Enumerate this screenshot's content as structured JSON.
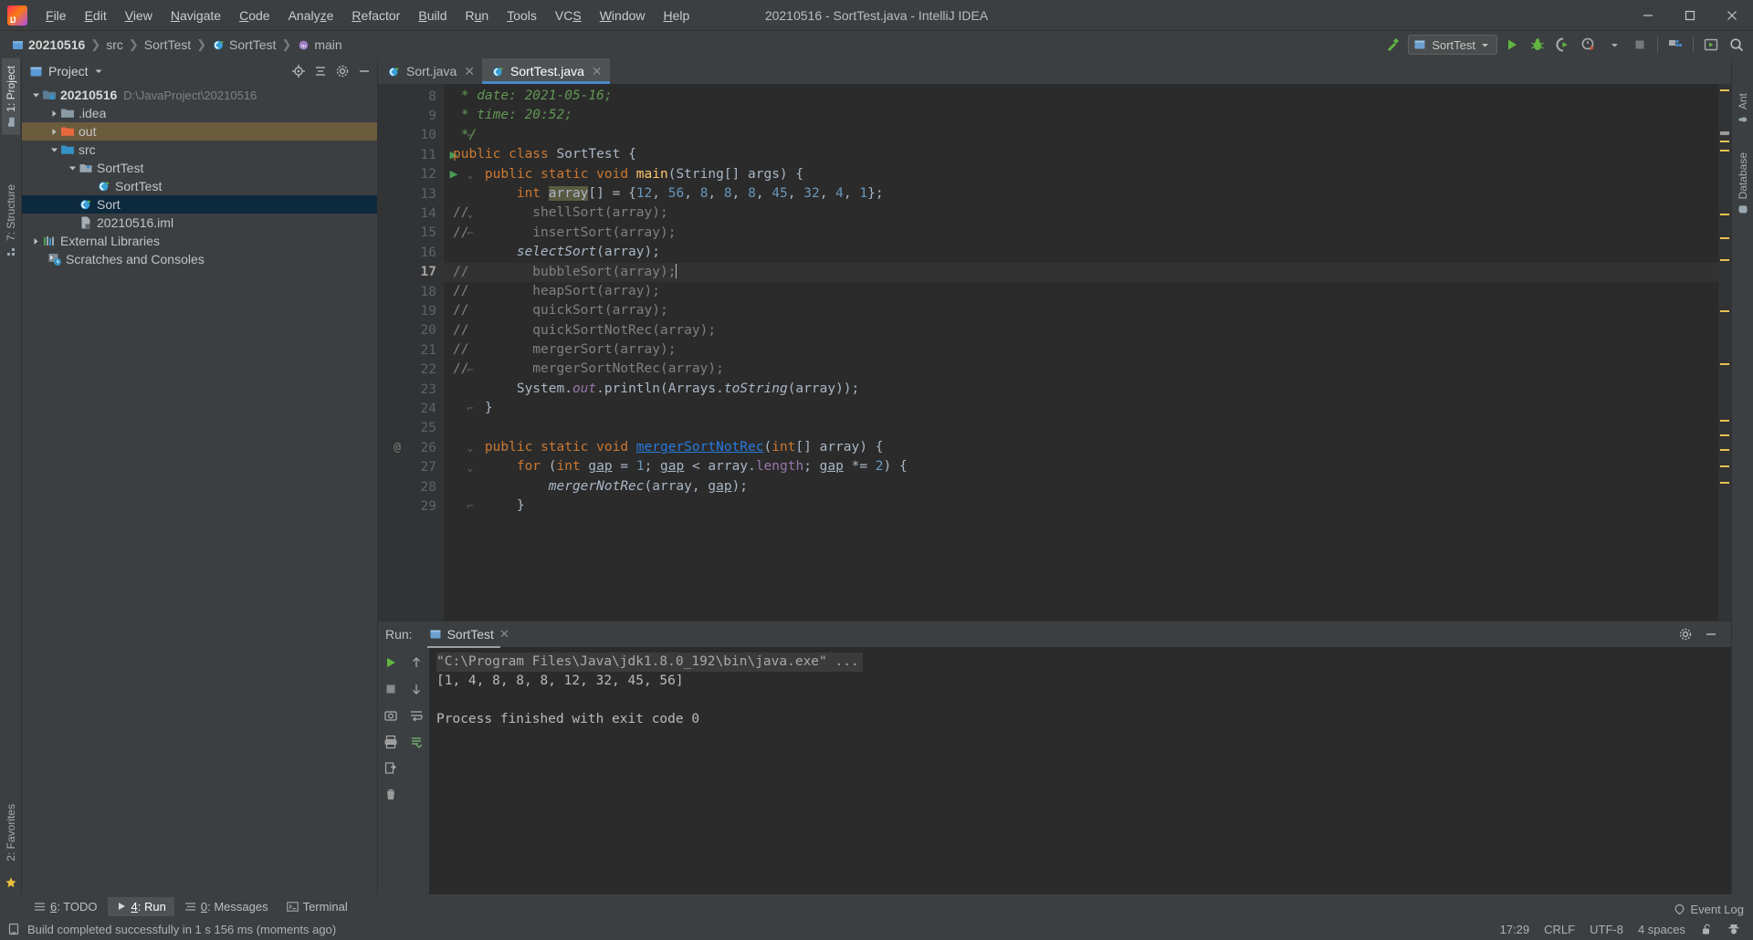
{
  "window": {
    "title": "20210516 - SortTest.java - IntelliJ IDEA",
    "minimize": "minimize-icon",
    "maximize": "maximize-icon",
    "close": "close-icon"
  },
  "menu": [
    {
      "label": "File",
      "mnemonic": "F"
    },
    {
      "label": "Edit",
      "mnemonic": "E"
    },
    {
      "label": "View",
      "mnemonic": "V"
    },
    {
      "label": "Navigate",
      "mnemonic": "N"
    },
    {
      "label": "Code",
      "mnemonic": "C"
    },
    {
      "label": "Analyze",
      "mnemonic": "z"
    },
    {
      "label": "Refactor",
      "mnemonic": "R"
    },
    {
      "label": "Build",
      "mnemonic": "B"
    },
    {
      "label": "Run",
      "mnemonic": "u"
    },
    {
      "label": "Tools",
      "mnemonic": "T"
    },
    {
      "label": "VCS",
      "mnemonic": "S"
    },
    {
      "label": "Window",
      "mnemonic": "W"
    },
    {
      "label": "Help",
      "mnemonic": "H"
    }
  ],
  "breadcrumbs": [
    {
      "label": "20210516",
      "icon": "project-icon",
      "bold": true
    },
    {
      "label": "src",
      "icon": "folder-icon",
      "bold": false
    },
    {
      "label": "SortTest",
      "icon": "package-icon",
      "bold": false
    },
    {
      "label": "SortTest",
      "icon": "class-icon",
      "bold": false
    },
    {
      "label": "main",
      "icon": "method-icon",
      "bold": false
    }
  ],
  "toolbar": {
    "build_icon": "hammer-icon",
    "run_config": "SortTest",
    "run_config_icon": "app-icon",
    "dropdown_icon": "chevron-down-icon",
    "run_icon": "run-icon",
    "debug_icon": "debug-icon",
    "coverage_icon": "run-with-coverage-icon",
    "profile_icon": "profile-icon",
    "profile_dropdown_icon": "chevron-down-icon",
    "stop_icon": "stop-icon",
    "project_structure_icon": "project-structure-icon",
    "updates_icon": "updates-icon",
    "search_icon": "search-everywhere-icon"
  },
  "left_strip": [
    {
      "label": "1: Project",
      "icon": "project-folder-icon",
      "active": true
    },
    {
      "label": "7: Structure",
      "icon": "structure-icon",
      "active": false
    },
    {
      "label": "2: Favorites",
      "icon": "favorites-icon",
      "active": false
    }
  ],
  "right_strip": [
    {
      "label": "Ant",
      "icon": "ant-icon"
    },
    {
      "label": "Database",
      "icon": "database-icon"
    }
  ],
  "project_panel": {
    "title": "Project",
    "dropdown_icon": "chevron-down-icon",
    "panel_icon": "project-view-icon",
    "locate_icon": "locate-icon",
    "collapse_icon": "collapse-all-icon",
    "settings_icon": "gear-icon",
    "hide_icon": "hide-icon",
    "tree": [
      {
        "label": "20210516",
        "path": "D:\\JavaProject\\20210516",
        "icon": "module-icon",
        "indent": 0,
        "arrow": "down",
        "bold": true,
        "state": "normal"
      },
      {
        "label": ".idea",
        "path": "",
        "icon": "folder-icon",
        "indent": 1,
        "arrow": "right",
        "bold": false,
        "state": "normal"
      },
      {
        "label": "out",
        "path": "",
        "icon": "folder-excluded-icon",
        "indent": 1,
        "arrow": "right",
        "bold": false,
        "state": "highlight"
      },
      {
        "label": "src",
        "path": "",
        "icon": "source-folder-icon",
        "indent": 1,
        "arrow": "down",
        "bold": false,
        "state": "normal"
      },
      {
        "label": "SortTest",
        "path": "",
        "icon": "package-icon",
        "indent": 2,
        "arrow": "down",
        "bold": false,
        "state": "normal"
      },
      {
        "label": "SortTest",
        "path": "",
        "icon": "class-icon",
        "indent": 3,
        "arrow": "none",
        "bold": false,
        "state": "normal"
      },
      {
        "label": "Sort",
        "path": "",
        "icon": "class-icon",
        "indent": 2,
        "arrow": "none",
        "bold": false,
        "state": "selected"
      },
      {
        "label": "20210516.iml",
        "path": "",
        "icon": "iml-file-icon",
        "indent": 2,
        "arrow": "none",
        "bold": false,
        "state": "normal"
      },
      {
        "label": "External Libraries",
        "path": "",
        "icon": "libraries-icon",
        "indent": 0,
        "arrow": "right",
        "bold": false,
        "state": "normal"
      },
      {
        "label": "Scratches and Consoles",
        "path": "",
        "icon": "scratches-icon",
        "indent": 0,
        "arrow": "none",
        "bold": false,
        "state": "normal"
      }
    ]
  },
  "editor": {
    "tabs": [
      {
        "label": "Sort.java",
        "icon": "class-icon",
        "active": false
      },
      {
        "label": "SortTest.java",
        "icon": "class-icon",
        "active": true
      }
    ],
    "current_line": 17,
    "first_line": 8,
    "lines": [
      {
        "n": 8,
        "fold": "",
        "run": false,
        "at": false
      },
      {
        "n": 9,
        "fold": "",
        "run": false,
        "at": false
      },
      {
        "n": 10,
        "fold": "end",
        "run": false,
        "at": false
      },
      {
        "n": 11,
        "fold": "",
        "run": true,
        "at": false
      },
      {
        "n": 12,
        "fold": "start",
        "run": true,
        "at": false
      },
      {
        "n": 13,
        "fold": "",
        "run": false,
        "at": false
      },
      {
        "n": 14,
        "fold": "start",
        "run": false,
        "at": false
      },
      {
        "n": 15,
        "fold": "end",
        "run": false,
        "at": false
      },
      {
        "n": 16,
        "fold": "",
        "run": false,
        "at": false
      },
      {
        "n": 17,
        "fold": "start",
        "run": false,
        "at": false
      },
      {
        "n": 18,
        "fold": "",
        "run": false,
        "at": false
      },
      {
        "n": 19,
        "fold": "",
        "run": false,
        "at": false
      },
      {
        "n": 20,
        "fold": "",
        "run": false,
        "at": false
      },
      {
        "n": 21,
        "fold": "",
        "run": false,
        "at": false
      },
      {
        "n": 22,
        "fold": "end",
        "run": false,
        "at": false
      },
      {
        "n": 23,
        "fold": "",
        "run": false,
        "at": false
      },
      {
        "n": 24,
        "fold": "end",
        "run": false,
        "at": false
      },
      {
        "n": 25,
        "fold": "",
        "run": false,
        "at": false
      },
      {
        "n": 26,
        "fold": "start",
        "run": false,
        "at": true
      },
      {
        "n": 27,
        "fold": "start",
        "run": false,
        "at": false
      },
      {
        "n": 28,
        "fold": "",
        "run": false,
        "at": false
      },
      {
        "n": 29,
        "fold": "end",
        "run": false,
        "at": false
      }
    ],
    "code_text": [
      "  * date: 2021-05-16;",
      "  * time: 20:52;",
      "  */",
      "public class SortTest {",
      "    public static void main(String[] args) {",
      "        int array[] = {12, 56, 8, 8, 8, 45, 32, 4, 1};",
      "//        shellSort(array);",
      "//        insertSort(array);",
      "        selectSort(array);",
      "//        bubbleSort(array);",
      "//        heapSort(array);",
      "//        quickSort(array);",
      "//        quickSortNotRec(array);",
      "//        mergerSort(array);",
      "//        mergerSortNotRec(array);",
      "        System.out.println(Arrays.toString(array));",
      "    }",
      "",
      "    public static void mergerSortNotRec(int[] array) {",
      "        for (int gap = 1; gap < array.length; gap *= 2) {",
      "            mergerNotRec(array, gap);",
      "        }"
    ]
  },
  "run_panel": {
    "label": "Run:",
    "tab_label": "SortTest",
    "tab_icon": "app-icon",
    "close_icon": "close-icon",
    "settings_icon": "gear-icon",
    "hide_icon": "hide-icon",
    "buttons": [
      "rerun-icon",
      "up-icon",
      "stop-icon",
      "down-icon",
      "screenshot-icon",
      "soft-wrap-icon",
      "print-icon",
      "scroll-to-end-icon",
      "export-icon",
      "clear-all-icon"
    ],
    "console": {
      "command": "\"C:\\Program Files\\Java\\jdk1.8.0_192\\bin\\java.exe\" ...",
      "output": "[1, 4, 8, 8, 8, 12, 32, 45, 56]",
      "exit": "Process finished with exit code 0"
    }
  },
  "bottom_tools": [
    {
      "label": "6: TODO",
      "mnemonic": "6",
      "icon": "todo-icon",
      "active": false
    },
    {
      "label": "4: Run",
      "mnemonic": "4",
      "icon": "run-icon",
      "active": true
    },
    {
      "label": "0: Messages",
      "mnemonic": "0",
      "icon": "messages-icon",
      "active": false
    },
    {
      "label": "Terminal",
      "mnemonic": "",
      "icon": "terminal-icon",
      "active": false
    }
  ],
  "status_bar": {
    "message": "Build completed successfully in 1 s 156 ms (moments ago)",
    "message_icon": "build-icon",
    "event_log": "Event Log",
    "event_log_icon": "event-log-icon",
    "time": "17:29",
    "line_separator": "CRLF",
    "encoding": "UTF-8",
    "indent": "4 spaces",
    "lock_icon": "unlock-icon",
    "inspector_icon": "hector-icon"
  },
  "colors": {
    "accent": "#4a88c7",
    "selection": "#0d293e",
    "highlight": "#6b5c3e",
    "green": "#499c54",
    "keyword": "#cc7832",
    "comment": "#808080",
    "doc_comment": "#629755",
    "number": "#6897bb",
    "method": "#ffc66d",
    "static_field": "#9876aa",
    "link": "#287bde",
    "editor_bg": "#2b2b2b",
    "panel_bg": "#3c3f41"
  }
}
